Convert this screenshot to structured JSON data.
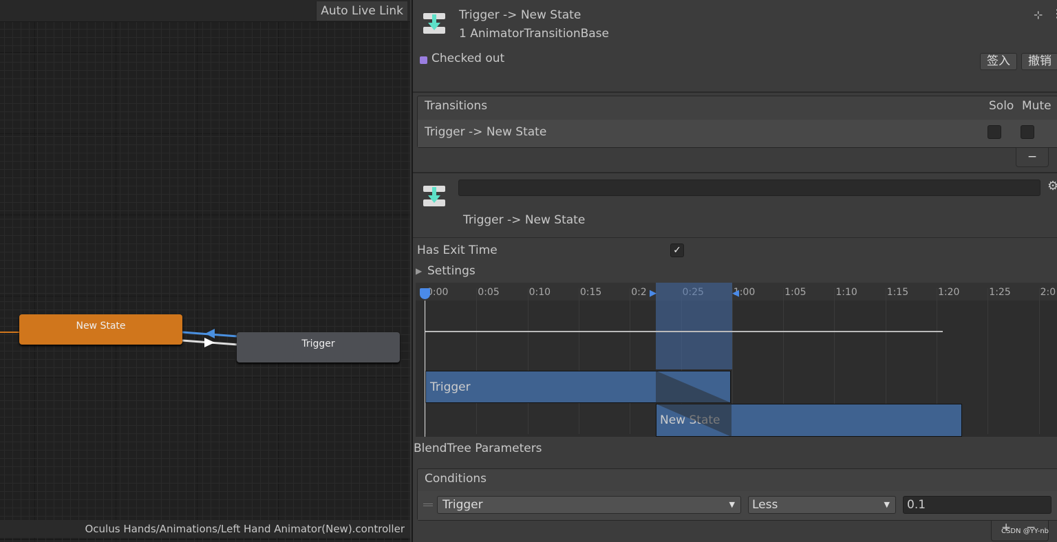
{
  "graph": {
    "auto_live_link": "Auto Live Link",
    "nodes": {
      "new_state": "New State",
      "trigger": "Trigger"
    },
    "path": "Oculus Hands/Animations/Left Hand Animator(New).controller",
    "colors": {
      "new_state": "#d0761c",
      "trigger": "#4d4f54",
      "transition": "#4a90e0"
    }
  },
  "header": {
    "title": "Trigger -> New State",
    "subtitle": "1 AnimatorTransitionBase",
    "status": "Checked out",
    "checkin": "签入",
    "revert": "撤销"
  },
  "transitions": {
    "header": "Transitions",
    "solo": "Solo",
    "mute": "Mute",
    "rows": [
      {
        "label": "Trigger -> New State",
        "solo": false,
        "mute": false
      }
    ],
    "remove": "−"
  },
  "transition": {
    "name_value": "",
    "title": "Trigger -> New State",
    "has_exit_time_label": "Has Exit Time",
    "has_exit_time": true,
    "settings": "Settings"
  },
  "timeline": {
    "ticks": [
      "0:00",
      "0:05",
      "0:10",
      "0:15",
      "0:2",
      "0:25",
      "1:00",
      "1:05",
      "1:10",
      "1:15",
      "1:20",
      "1:25",
      "2:0"
    ],
    "source": "Trigger",
    "dest": "New State"
  },
  "blendtree": "BlendTree Parameters",
  "conditions": {
    "header": "Conditions",
    "rows": [
      {
        "param": "Trigger",
        "mode": "Less",
        "value": "0.1"
      }
    ],
    "add": "+",
    "remove": "−"
  },
  "watermark": "CSDN @YY-nb"
}
